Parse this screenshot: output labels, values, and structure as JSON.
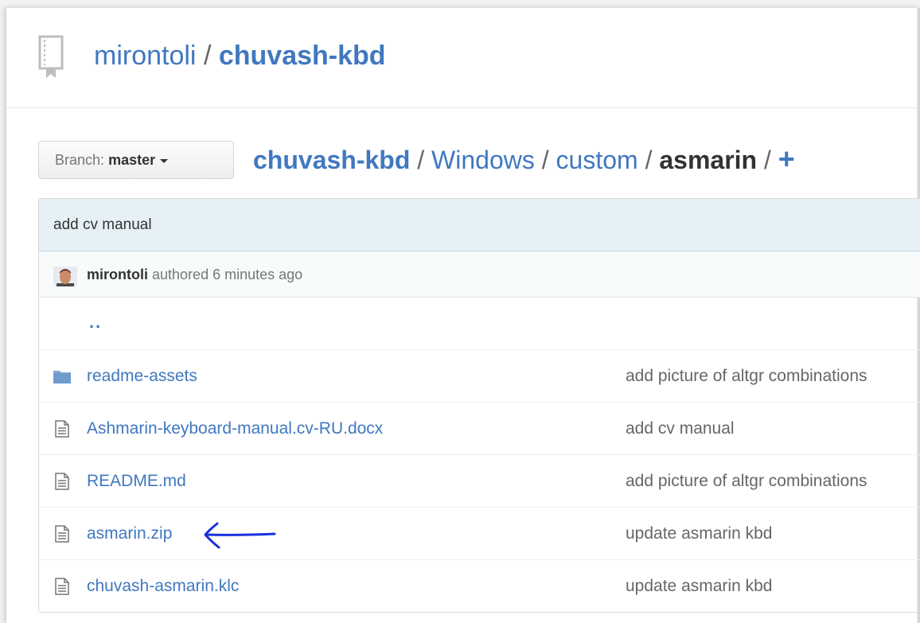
{
  "repo": {
    "owner": "mirontoli",
    "separator": "/",
    "name": "chuvash-kbd"
  },
  "branch": {
    "label": "Branch:",
    "name": "master"
  },
  "breadcrumb": {
    "root": "chuvash-kbd",
    "parts": [
      "Windows",
      "custom"
    ],
    "current": "asmarin",
    "separator": "/",
    "add": "+"
  },
  "commit": {
    "message": "add cv manual",
    "author": "mirontoli",
    "authored_text": "authored 6 minutes ago"
  },
  "updir": "..",
  "files": [
    {
      "name": "readme-assets",
      "message": "add picture of altgr combinations",
      "icon": "folder-icon"
    },
    {
      "name": "Ashmarin-keyboard-manual.cv-RU.docx",
      "message": "add cv manual",
      "icon": "file-icon"
    },
    {
      "name": "README.md",
      "message": "add picture of altgr combinations",
      "icon": "file-icon"
    },
    {
      "name": "asmarin.zip",
      "message": "update asmarin kbd",
      "icon": "file-icon"
    },
    {
      "name": "chuvash-asmarin.klc",
      "message": "update asmarin kbd",
      "icon": "file-icon"
    }
  ],
  "annotation": {
    "icon": "hand-drawn-arrow-icon",
    "color": "#1a2fe0"
  },
  "colors": {
    "link": "#4078c0",
    "commit_bar": "#e6f1f6"
  }
}
